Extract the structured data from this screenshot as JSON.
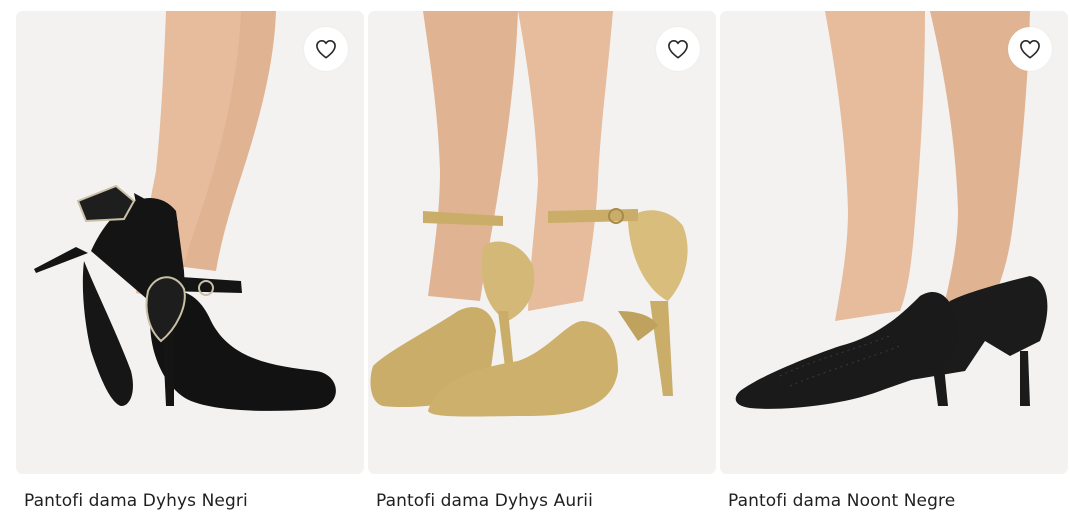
{
  "products": [
    {
      "title": "Pantofi dama Dyhys Negri",
      "favorite_icon": "heart-outline-icon",
      "image": "black-bow-heels-photo",
      "shoe_color": "#141414",
      "accent_color": "#c9c0a6"
    },
    {
      "title": "Pantofi dama Dyhys Aurii",
      "favorite_icon": "heart-outline-icon",
      "image": "gold-bow-heels-photo",
      "shoe_color": "#c9ad68",
      "accent_color": "#e2cf97"
    },
    {
      "title": "Pantofi dama Noont Negre",
      "favorite_icon": "heart-outline-icon",
      "image": "black-mesh-pumps-photo",
      "shoe_color": "#1b1b1b",
      "accent_color": "#3a3a3a"
    }
  ],
  "colors": {
    "photo_background": "#f3f2f1",
    "skin": "#e3b796",
    "title_text": "#1f1f1f"
  }
}
